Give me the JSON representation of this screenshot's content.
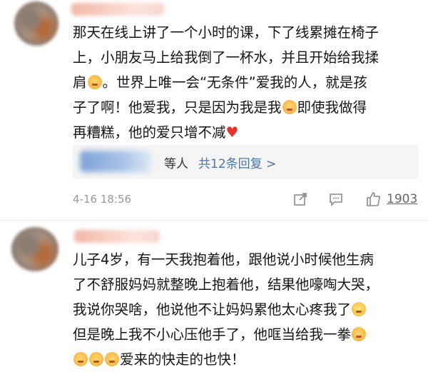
{
  "comments": [
    {
      "lines": [
        "那天在线上讲了一个小时的课，下了线累摊在椅子",
        "上，小朋友马上给我倒了一杯水，并且开始给我揉",
        "肩",
        "。世界上唯一会“无条件”爱我的人，就是孩",
        "子了啊！他爱我，只是因为我是我",
        "即使我做得",
        "再糟糕，他的爱只增不减"
      ],
      "reply": {
        "suffix": "等人",
        "link": "共12条回复 >"
      },
      "timestamp": "4-16 18:56",
      "likes": "1903"
    },
    {
      "lines": [
        "儿子4岁，有一天我抱着他，跟他说小时候他生病",
        "了不舒服妈妈就整晚上抱着他，结果他嚎啕大哭，",
        "我说你哭啥，他说他不让妈妈累他太心疼我了",
        "但是晚上我不小心压他手了，他哐当给我一拳",
        "爱来的快走的也快！"
      ]
    }
  ],
  "icons": {
    "emoji_kiss": "kissing-face-icon",
    "emoji_lol": "laughing-tears-icon",
    "emoji_shush": "shushing-face-icon",
    "heart": "red-heart-icon",
    "share": "share-icon",
    "comment": "comment-icon",
    "like": "thumbs-up-icon"
  },
  "colors": {
    "link": "#4b74a8",
    "meta": "#9a9a9a",
    "heart": "#e8312f"
  }
}
